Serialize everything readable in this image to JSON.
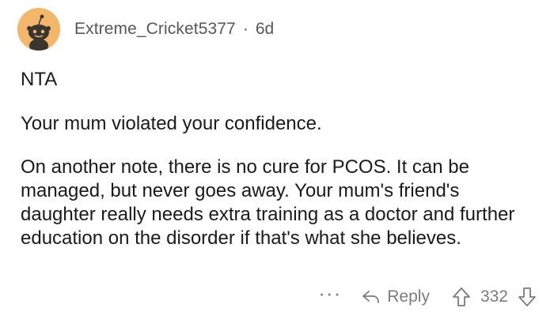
{
  "comment": {
    "author": "Extreme_Cricket5377",
    "separator": "·",
    "age": "6d",
    "paragraphs": [
      "NTA",
      "Your mum violated your confidence.",
      "On another note, there is no cure for PCOS. It can be managed, but never goes away. Your mum's friend's daughter really needs extra training as a doctor and further education on the disorder if that's what she believes."
    ],
    "actions": {
      "more": "···",
      "reply_label": "Reply",
      "score": "332"
    }
  },
  "icons": {
    "avatar": "reddit-snoo-avatar",
    "reply": "reply-arrow-icon",
    "upvote": "upvote-arrow-icon",
    "downvote": "downvote-arrow-icon"
  },
  "colors": {
    "avatar_bg": "#f2b76a",
    "meta_text": "#555759",
    "action_text": "#7c7c7d",
    "body_text": "#1a1a1b"
  }
}
